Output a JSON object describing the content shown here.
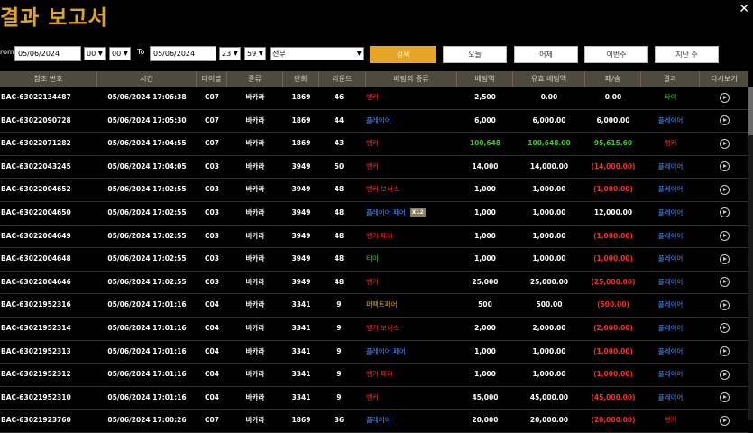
{
  "title": "결과 보고서",
  "close_glyph": "✕",
  "colors": {
    "accent": "#e0a526",
    "banker": "#ff2b2b",
    "player": "#4a8cff",
    "tie": "#35d11b",
    "loss": "#ff2b2b",
    "win_highlight": "#35d11b"
  },
  "filters": {
    "from_label": "rom",
    "from_date": "05/06/2024",
    "from_hour": "00",
    "from_min": "00",
    "to_label": "To",
    "to_date": "05/06/2024",
    "to_hour": "23",
    "to_min": "59",
    "type_value": "전부",
    "search_button": "검색",
    "today_button": "오늘",
    "yesterday_button": "어제",
    "this_week_button": "이번주",
    "last_week_button": "지난 주"
  },
  "columns": [
    "참조 번호",
    "시간",
    "테이블",
    "종류",
    "단화",
    "라운드",
    "베팅의 종류",
    "베팅액",
    "유효 베팅액",
    "패/승",
    "결과",
    "다시보기"
  ],
  "rows": [
    {
      "ref": "BAC-63022134487",
      "time": "05/06/2024 17:06:38",
      "table": "C07",
      "kind": "바카라",
      "shoe": "1869",
      "round": "46",
      "bet_type": "뱅커",
      "bet_type_color": "banker",
      "badge": "",
      "bet": "2,500",
      "valid": "0.00",
      "winloss": "0.00",
      "winloss_color": "white",
      "result": "타이",
      "result_color": "tie",
      "bet_color": "white"
    },
    {
      "ref": "BAC-63022090728",
      "time": "05/06/2024 17:05:30",
      "table": "C07",
      "kind": "바카라",
      "shoe": "1869",
      "round": "44",
      "bet_type": "플레이어",
      "bet_type_color": "player",
      "badge": "",
      "bet": "6,000",
      "valid": "6,000.00",
      "winloss": "6,000.00",
      "winloss_color": "white",
      "result": "플레이어",
      "result_color": "player",
      "bet_color": "white"
    },
    {
      "ref": "BAC-63022071282",
      "time": "05/06/2024 17:04:55",
      "table": "C07",
      "kind": "바카라",
      "shoe": "1869",
      "round": "43",
      "bet_type": "뱅커",
      "bet_type_color": "banker",
      "badge": "",
      "bet": "100,648",
      "valid": "100,648.00",
      "winloss": "95,615.60",
      "winloss_color": "win_highlight",
      "result": "뱅커",
      "result_color": "banker",
      "bet_color": "win_highlight"
    },
    {
      "ref": "BAC-63022043245",
      "time": "05/06/2024 17:04:05",
      "table": "C03",
      "kind": "바카라",
      "shoe": "3949",
      "round": "50",
      "bet_type": "뱅커",
      "bet_type_color": "banker",
      "badge": "",
      "bet": "14,000",
      "valid": "14,000.00",
      "winloss": "(14,000.00)",
      "winloss_color": "loss",
      "result": "플레이어",
      "result_color": "player",
      "bet_color": "white"
    },
    {
      "ref": "BAC-63022004652",
      "time": "05/06/2024 17:02:55",
      "table": "C03",
      "kind": "바카라",
      "shoe": "3949",
      "round": "48",
      "bet_type": "뱅커 보너스",
      "bet_type_color": "banker",
      "badge": "",
      "bet": "1,000",
      "valid": "1,000.00",
      "winloss": "(1,000.00)",
      "winloss_color": "loss",
      "result": "플레이어",
      "result_color": "player",
      "bet_color": "white"
    },
    {
      "ref": "BAC-63022004650",
      "time": "05/06/2024 17:02:55",
      "table": "C03",
      "kind": "바카라",
      "shoe": "3949",
      "round": "48",
      "bet_type": "플레이어 페어",
      "bet_type_color": "player",
      "badge": "X12",
      "bet": "1,000",
      "valid": "1,000.00",
      "winloss": "12,000.00",
      "winloss_color": "white",
      "result": "플레이어",
      "result_color": "player",
      "bet_color": "white"
    },
    {
      "ref": "BAC-63022004649",
      "time": "05/06/2024 17:02:55",
      "table": "C03",
      "kind": "바카라",
      "shoe": "3949",
      "round": "48",
      "bet_type": "뱅커 페어",
      "bet_type_color": "banker",
      "badge": "",
      "bet": "1,000",
      "valid": "1,000.00",
      "winloss": "(1,000.00)",
      "winloss_color": "loss",
      "result": "플레이어",
      "result_color": "player",
      "bet_color": "white"
    },
    {
      "ref": "BAC-63022004648",
      "time": "05/06/2024 17:02:55",
      "table": "C03",
      "kind": "바카라",
      "shoe": "3949",
      "round": "48",
      "bet_type": "타이",
      "bet_type_color": "tie",
      "badge": "",
      "bet": "1,000",
      "valid": "1,000.00",
      "winloss": "(1,000.00)",
      "winloss_color": "loss",
      "result": "플레이어",
      "result_color": "player",
      "bet_color": "white"
    },
    {
      "ref": "BAC-63022004646",
      "time": "05/06/2024 17:02:55",
      "table": "C03",
      "kind": "바카라",
      "shoe": "3949",
      "round": "48",
      "bet_type": "뱅커",
      "bet_type_color": "banker",
      "badge": "",
      "bet": "25,000",
      "valid": "25,000.00",
      "winloss": "(25,000.00)",
      "winloss_color": "loss",
      "result": "플레이어",
      "result_color": "player",
      "bet_color": "white"
    },
    {
      "ref": "BAC-63021952316",
      "time": "05/06/2024 17:01:16",
      "table": "C04",
      "kind": "바카라",
      "shoe": "3341",
      "round": "9",
      "bet_type": "퍼펙트페어",
      "bet_type_color": "gold",
      "badge": "",
      "bet": "500",
      "valid": "500.00",
      "winloss": "(500.00)",
      "winloss_color": "loss",
      "result": "플레이어",
      "result_color": "player",
      "bet_color": "white"
    },
    {
      "ref": "BAC-63021952314",
      "time": "05/06/2024 17:01:16",
      "table": "C04",
      "kind": "바카라",
      "shoe": "3341",
      "round": "9",
      "bet_type": "뱅커 보너스",
      "bet_type_color": "banker",
      "badge": "",
      "bet": "2,000",
      "valid": "2,000.00",
      "winloss": "(2,000.00)",
      "winloss_color": "loss",
      "result": "플레이어",
      "result_color": "player",
      "bet_color": "white"
    },
    {
      "ref": "BAC-63021952313",
      "time": "05/06/2024 17:01:16",
      "table": "C04",
      "kind": "바카라",
      "shoe": "3341",
      "round": "9",
      "bet_type": "플레이어 페어",
      "bet_type_color": "player",
      "badge": "",
      "bet": "1,000",
      "valid": "1,000.00",
      "winloss": "(1,000.00)",
      "winloss_color": "loss",
      "result": "플레이어",
      "result_color": "player",
      "bet_color": "white"
    },
    {
      "ref": "BAC-63021952312",
      "time": "05/06/2024 17:01:16",
      "table": "C04",
      "kind": "바카라",
      "shoe": "3341",
      "round": "9",
      "bet_type": "뱅커 페어",
      "bet_type_color": "banker",
      "badge": "",
      "bet": "1,000",
      "valid": "1,000.00",
      "winloss": "(1,000.00)",
      "winloss_color": "loss",
      "result": "플레이어",
      "result_color": "player",
      "bet_color": "white"
    },
    {
      "ref": "BAC-63021952310",
      "time": "05/06/2024 17:01:16",
      "table": "C04",
      "kind": "바카라",
      "shoe": "3341",
      "round": "9",
      "bet_type": "뱅커",
      "bet_type_color": "banker",
      "badge": "",
      "bet": "45,000",
      "valid": "45,000.00",
      "winloss": "(45,000.00)",
      "winloss_color": "loss",
      "result": "플레이어",
      "result_color": "player",
      "bet_color": "white"
    },
    {
      "ref": "BAC-63021923760",
      "time": "05/06/2024 17:00:26",
      "table": "C07",
      "kind": "바카라",
      "shoe": "1869",
      "round": "36",
      "bet_type": "플레이어",
      "bet_type_color": "player",
      "badge": "",
      "bet": "20,000",
      "valid": "20,000.00",
      "winloss": "(20,000.00)",
      "winloss_color": "loss",
      "result": "뱅커",
      "result_color": "banker",
      "bet_color": "white"
    }
  ]
}
